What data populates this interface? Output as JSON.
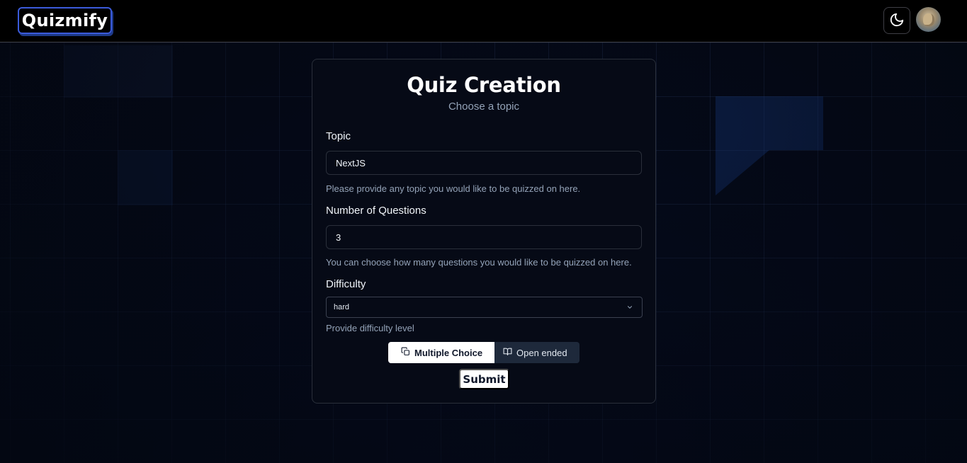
{
  "app": {
    "logo_text": "Quizmify"
  },
  "header": {
    "theme_toggle_icon": "moon-icon",
    "avatar_icon": "user-avatar"
  },
  "form": {
    "title": "Quiz Creation",
    "subtitle": "Choose a topic",
    "topic": {
      "label": "Topic",
      "value": "NextJS",
      "help": "Please provide any topic you would like to be quizzed on here."
    },
    "amount": {
      "label": "Number of Questions",
      "value": "3",
      "help": "You can choose how many questions you would like to be quizzed on here."
    },
    "difficulty": {
      "label": "Difficulty",
      "selected": "hard",
      "help": "Provide difficulty level"
    },
    "type_toggle": {
      "multiple_choice_label": "Multiple Choice",
      "open_ended_label": "Open ended",
      "selected": "Multiple Choice"
    },
    "submit_label": "Submit"
  },
  "colors": {
    "background": "#030712",
    "accent": "#3b5bdb",
    "card_border": "#2a2f3a"
  }
}
